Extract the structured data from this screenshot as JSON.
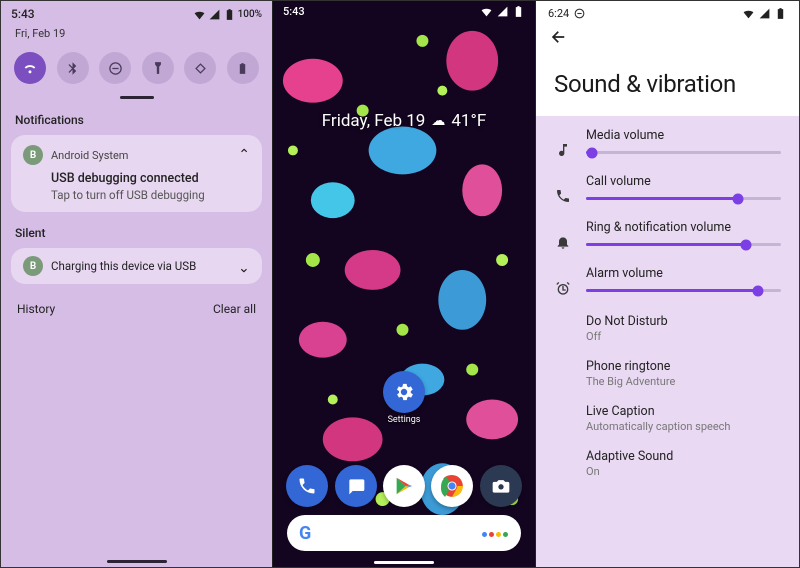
{
  "panel1": {
    "status": {
      "time": "5:43",
      "battery": "100%"
    },
    "date": "Fri, Feb 19",
    "qs_tiles": [
      {
        "name": "wifi",
        "active": true
      },
      {
        "name": "bluetooth",
        "active": false
      },
      {
        "name": "dnd",
        "active": false
      },
      {
        "name": "flashlight",
        "active": false
      },
      {
        "name": "autorotate",
        "active": false
      },
      {
        "name": "battery-saver",
        "active": false
      }
    ],
    "section_notifications": "Notifications",
    "notif": {
      "app": "Android System",
      "title": "USB debugging connected",
      "body": "Tap to turn off USB debugging"
    },
    "section_silent": "Silent",
    "silent_notif": {
      "text": "Charging this device via USB"
    },
    "footer": {
      "history": "History",
      "clear": "Clear all"
    }
  },
  "panel2": {
    "status": {
      "time": "5:43"
    },
    "datetime": "Friday, Feb 19",
    "temperature": "41°F",
    "settings_app": {
      "label": "Settings"
    },
    "dock_apps": [
      "phone",
      "messages",
      "play-store",
      "chrome",
      "camera"
    ]
  },
  "panel3": {
    "status": {
      "time": "6:24"
    },
    "title": "Sound & vibration",
    "sliders": [
      {
        "name": "Media volume",
        "icon": "music-note",
        "value": 3
      },
      {
        "name": "Call volume",
        "icon": "phone",
        "value": 78
      },
      {
        "name": "Ring & notification volume",
        "icon": "bell",
        "value": 82
      },
      {
        "name": "Alarm volume",
        "icon": "alarm",
        "value": 88
      }
    ],
    "rows": [
      {
        "name": "Do Not Disturb",
        "sub": "Off"
      },
      {
        "name": "Phone ringtone",
        "sub": "The Big Adventure"
      },
      {
        "name": "Live Caption",
        "sub": "Automatically caption speech"
      },
      {
        "name": "Adaptive Sound",
        "sub": "On"
      }
    ]
  }
}
